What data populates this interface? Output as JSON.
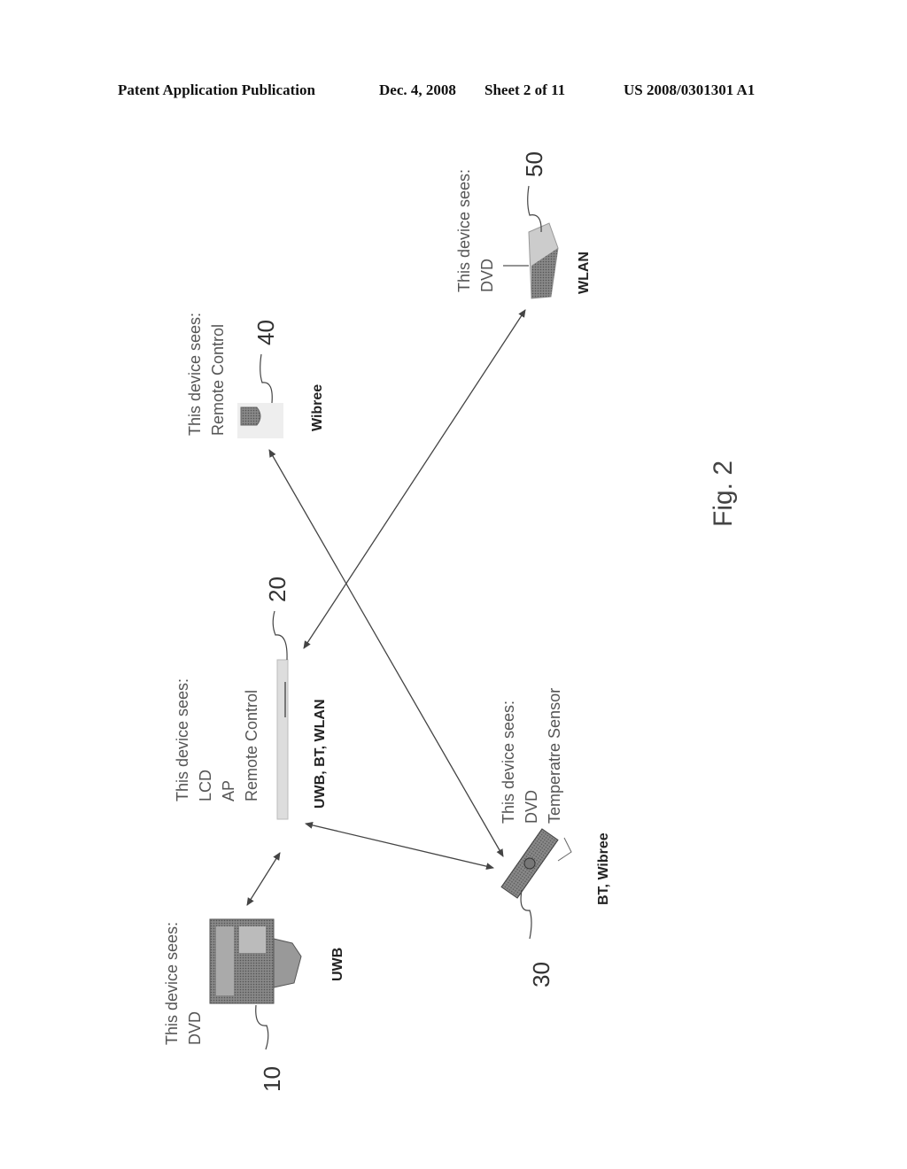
{
  "header": {
    "publication": "Patent Application Publication",
    "date": "Dec. 4, 2008",
    "sheet": "Sheet 2 of 11",
    "number": "US 2008/0301301 A1"
  },
  "figure": {
    "caption": "Fig. 2",
    "devices": [
      {
        "ref": "10",
        "tech": "UWB",
        "sees_title": "This device sees:",
        "sees": [
          "DVD"
        ],
        "icon": "monitor-icon"
      },
      {
        "ref": "20",
        "tech": "UWB, BT, WLAN",
        "sees_title": "This device sees:",
        "sees": [
          "LCD",
          "AP",
          "Remote Control"
        ],
        "icon": "dvd-player-icon"
      },
      {
        "ref": "30",
        "tech": "BT, Wibree",
        "sees_title": "This device sees:",
        "sees": [
          "DVD",
          "Temperatre Sensor"
        ],
        "icon": "remote-control-icon"
      },
      {
        "ref": "40",
        "tech": "Wibree",
        "sees_title": "This device sees:",
        "sees": [
          "Remote Control"
        ],
        "icon": "sensor-icon"
      },
      {
        "ref": "50",
        "tech": "WLAN",
        "sees_title": "This device sees:",
        "sees": [
          "DVD"
        ],
        "icon": "access-point-icon"
      }
    ],
    "links": [
      {
        "from": "10",
        "to": "20"
      },
      {
        "from": "20",
        "to": "30"
      },
      {
        "from": "30",
        "to": "40"
      },
      {
        "from": "20",
        "to": "50"
      }
    ]
  }
}
